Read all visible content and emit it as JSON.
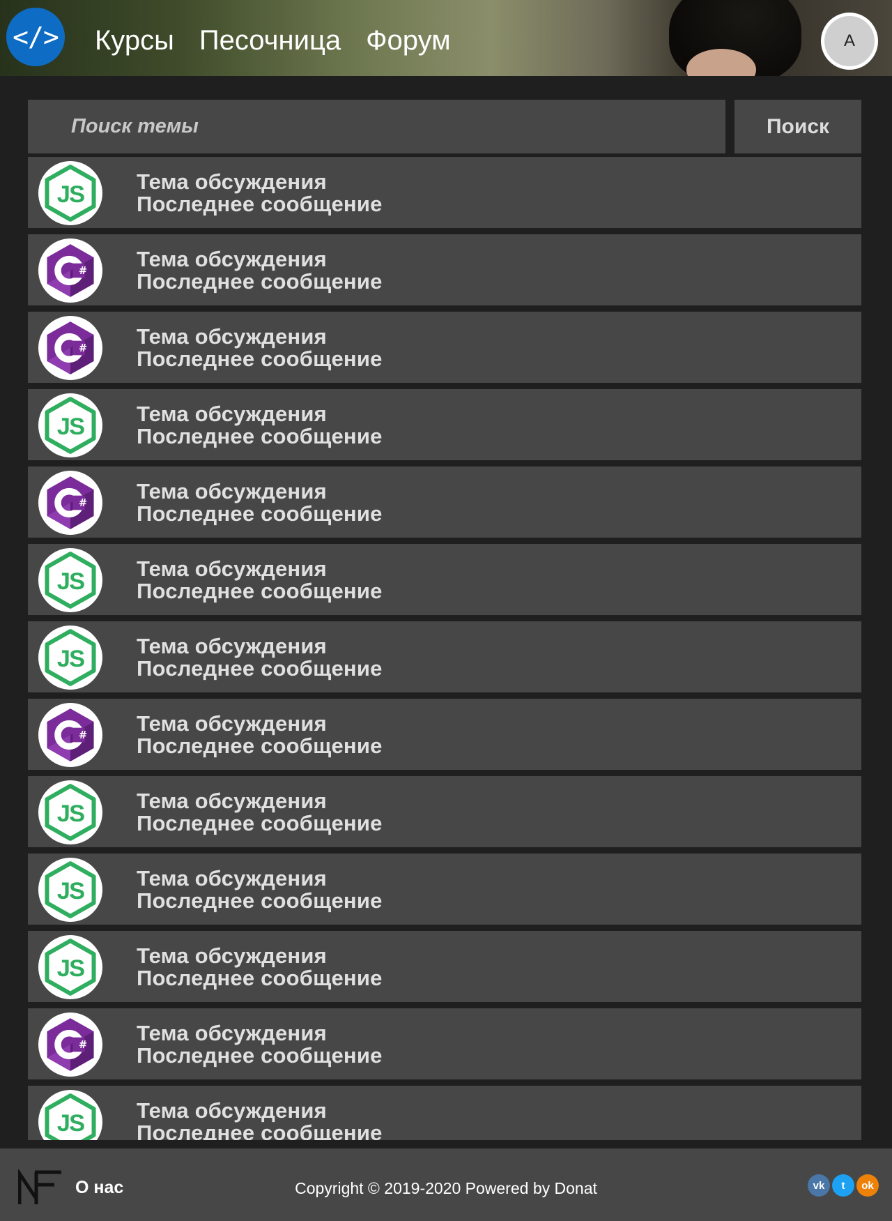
{
  "header": {
    "logo_glyph": "</>",
    "nav": [
      {
        "label": "Курсы"
      },
      {
        "label": "Песочница"
      },
      {
        "label": "Форум"
      }
    ],
    "avatar_initial": "A"
  },
  "search": {
    "placeholder": "Поиск темы",
    "button_label": "Поиск"
  },
  "colors": {
    "js_green": "#2fae5f",
    "csharp_purple": "#7b2c9a",
    "logo_blue": "#0e6cc4",
    "row_bg": "#474747"
  },
  "topics": [
    {
      "icon": "js-icon",
      "title": "Тема обсуждения",
      "last": "Последнее сообщение"
    },
    {
      "icon": "csharp-icon",
      "title": "Тема обсуждения",
      "last": "Последнее сообщение"
    },
    {
      "icon": "csharp-icon",
      "title": "Тема обсуждения",
      "last": "Последнее сообщение"
    },
    {
      "icon": "js-icon",
      "title": "Тема обсуждения",
      "last": "Последнее сообщение"
    },
    {
      "icon": "csharp-icon",
      "title": "Тема обсуждения",
      "last": "Последнее сообщение"
    },
    {
      "icon": "js-icon",
      "title": "Тема обсуждения",
      "last": "Последнее сообщение"
    },
    {
      "icon": "js-icon",
      "title": "Тема обсуждения",
      "last": "Последнее сообщение"
    },
    {
      "icon": "csharp-icon",
      "title": "Тема обсуждения",
      "last": "Последнее сообщение"
    },
    {
      "icon": "js-icon",
      "title": "Тема обсуждения",
      "last": "Последнее сообщение"
    },
    {
      "icon": "js-icon",
      "title": "Тема обсуждения",
      "last": "Последнее сообщение"
    },
    {
      "icon": "js-icon",
      "title": "Тема обсуждения",
      "last": "Последнее сообщение"
    },
    {
      "icon": "csharp-icon",
      "title": "Тема обсуждения",
      "last": "Последнее сообщение"
    },
    {
      "icon": "js-icon",
      "title": "Тема обсуждения",
      "last": "Последнее сообщение"
    }
  ],
  "footer": {
    "logo_text": "NF",
    "about_label": "О нас",
    "copyright": "Copyright © 2019-2020 Powered by Donat",
    "social": [
      {
        "icon": "vk-icon",
        "glyph": "vk"
      },
      {
        "icon": "twitter-icon",
        "glyph": "t"
      },
      {
        "icon": "odnoklassniki-icon",
        "glyph": "ok"
      }
    ]
  }
}
